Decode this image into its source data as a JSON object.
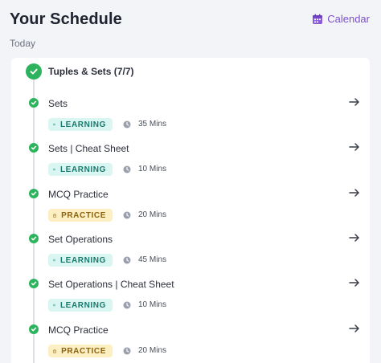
{
  "header": {
    "title": "Your Schedule",
    "calendar_label": "Calendar",
    "calendar_icon": "calendar-icon",
    "accent_color": "#7b4fd0"
  },
  "subtitle": "Today",
  "module": {
    "title": "Tuples & Sets (7/7)",
    "status": "completed",
    "status_color": "#2db35d"
  },
  "items": [
    {
      "title": "Sets",
      "type": "LEARNING",
      "duration": "35 Mins",
      "status": "completed"
    },
    {
      "title": "Sets | Cheat Sheet",
      "type": "LEARNING",
      "duration": "10 Mins",
      "status": "completed"
    },
    {
      "title": "MCQ Practice",
      "type": "PRACTICE",
      "duration": "20 Mins",
      "status": "completed"
    },
    {
      "title": "Set Operations",
      "type": "LEARNING",
      "duration": "45 Mins",
      "status": "completed"
    },
    {
      "title": "Set Operations | Cheat Sheet",
      "type": "LEARNING",
      "duration": "10 Mins",
      "status": "completed"
    },
    {
      "title": "MCQ Practice",
      "type": "PRACTICE",
      "duration": "20 Mins",
      "status": "completed"
    }
  ],
  "colors": {
    "learning_bg": "#d9f6f2",
    "learning_text": "#197a6d",
    "practice_bg": "#fcefc2",
    "practice_text": "#8a6210"
  }
}
